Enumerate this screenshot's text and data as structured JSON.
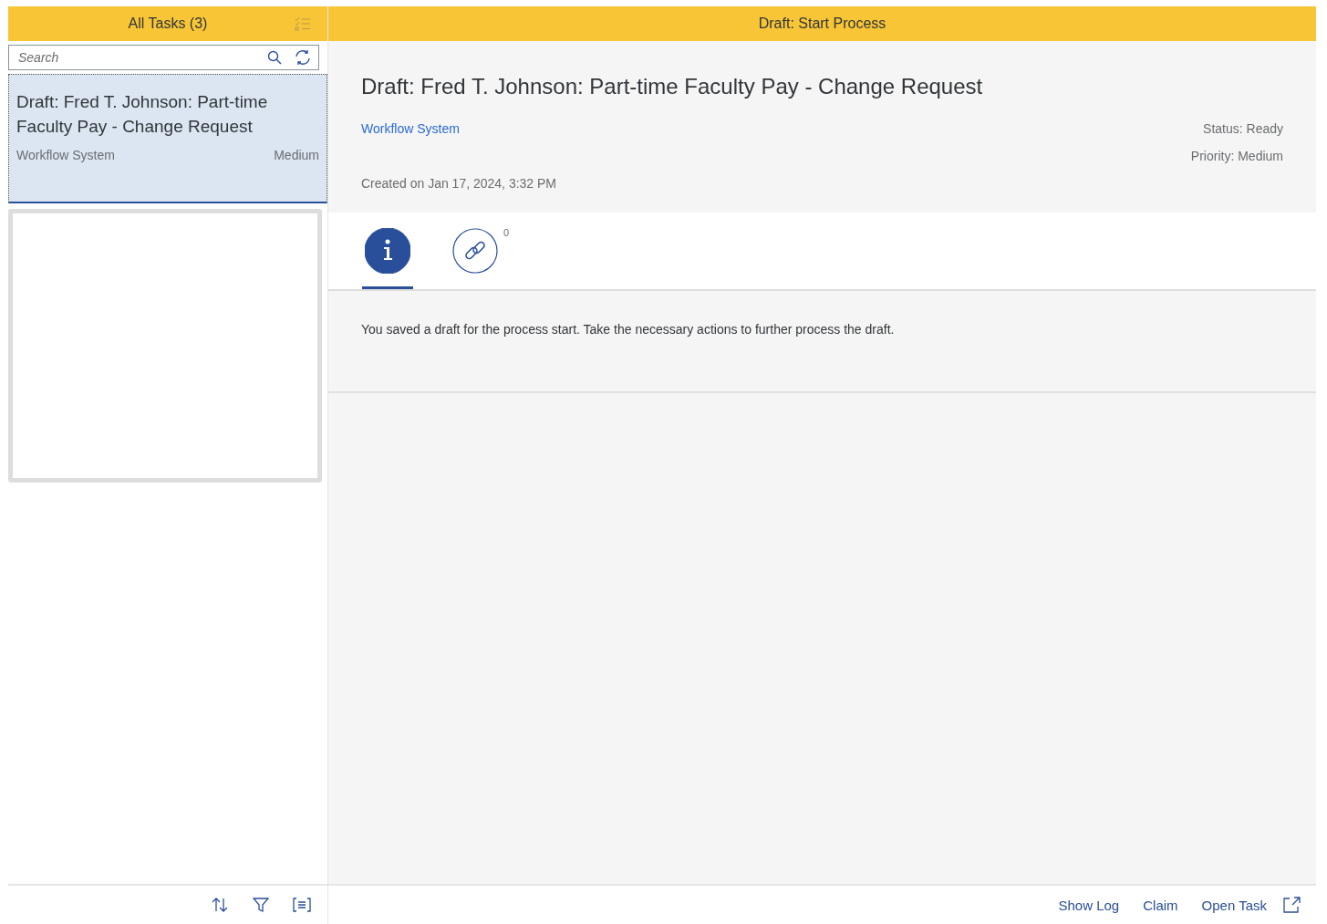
{
  "list_header": {
    "title": "All Tasks (3)"
  },
  "search": {
    "placeholder": "Search"
  },
  "tasks": [
    {
      "title": "Draft: Fred T. Johnson: Part-time Faculty Pay - Change Request",
      "creator": "Workflow System",
      "priority": "Medium",
      "selected": true
    }
  ],
  "detail_header": {
    "title": "Draft: Start Process"
  },
  "detail": {
    "title": "Draft: Fred T. Johnson: Part-time Faculty Pay - Change Request",
    "creator": "Workflow System",
    "status": "Status: Ready",
    "priority": "Priority: Medium",
    "created": "Created on Jan 17, 2024, 3:32 PM"
  },
  "tabs": [
    {
      "kind": "info",
      "selected": true
    },
    {
      "kind": "link",
      "selected": false,
      "count": "0"
    }
  ],
  "description": "You saved a draft for the process start. Take the necessary actions to further process the draft.",
  "footer_actions": [
    "Show Log",
    "Claim",
    "Open Task"
  ]
}
